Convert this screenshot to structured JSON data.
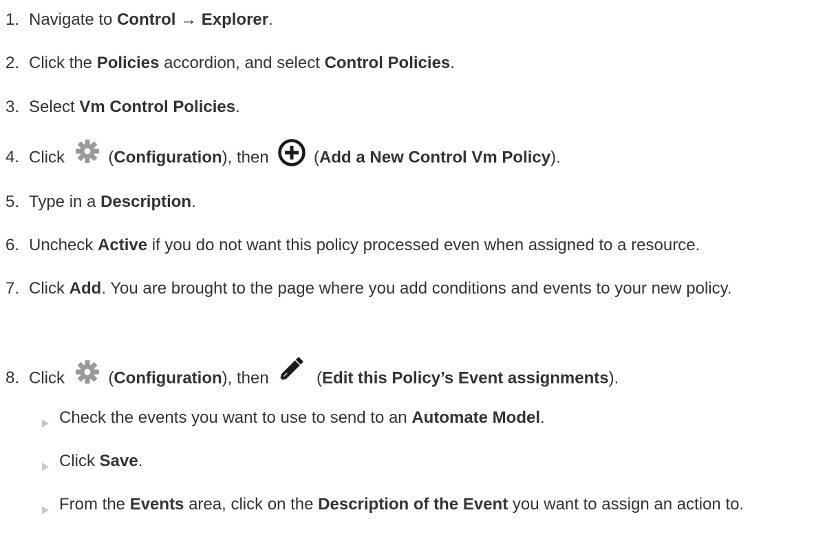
{
  "steps": [
    {
      "num": "1.",
      "parts": [
        "Navigate to ",
        "Control",
        " → ",
        "Explorer",
        "."
      ]
    },
    {
      "num": "2.",
      "parts": [
        "Click the ",
        "Policies",
        " accordion, and select ",
        "Control Policies",
        "."
      ]
    },
    {
      "num": "3.",
      "parts": [
        "Select ",
        "Vm Control Policies",
        "."
      ]
    },
    {
      "num": "4.",
      "parts": [
        "Click ",
        " (",
        "Configuration",
        "), then ",
        " (",
        "Add a New Control Vm Policy",
        ")."
      ]
    },
    {
      "num": "5.",
      "parts": [
        "Type in a ",
        "Description",
        "."
      ]
    },
    {
      "num": "6.",
      "parts": [
        "Uncheck ",
        "Active",
        " if you do not want this policy processed even when assigned to a resource."
      ]
    },
    {
      "num": "7.",
      "parts": [
        "Click ",
        "Add",
        ". You are brought to the page where you add conditions and events to your new policy."
      ]
    },
    {
      "num": "8.",
      "parts": [
        "Click ",
        " (",
        "Configuration",
        "), then ",
        " (",
        "Edit this Policy’s Event assignments",
        ")."
      ]
    }
  ],
  "substeps": [
    {
      "parts": [
        "Check the events you want to use to send to an ",
        "Automate Model",
        "."
      ]
    },
    {
      "parts": [
        "Click ",
        "Save",
        "."
      ]
    },
    {
      "parts": [
        "From the ",
        "Events",
        " area, click on the ",
        "Description of the Event",
        " you want to assign an action to."
      ]
    }
  ],
  "icons": {
    "configuration": "gear-icon",
    "add_policy": "plus-circle-icon",
    "edit_assignments": "pencil-icon",
    "bullet": "triangle-bullet-icon"
  },
  "colors": {
    "text": "#333333",
    "icon_gray": "#9a9a9a",
    "icon_dark": "#1a1a1a",
    "bullet": "#c8c8c8"
  }
}
